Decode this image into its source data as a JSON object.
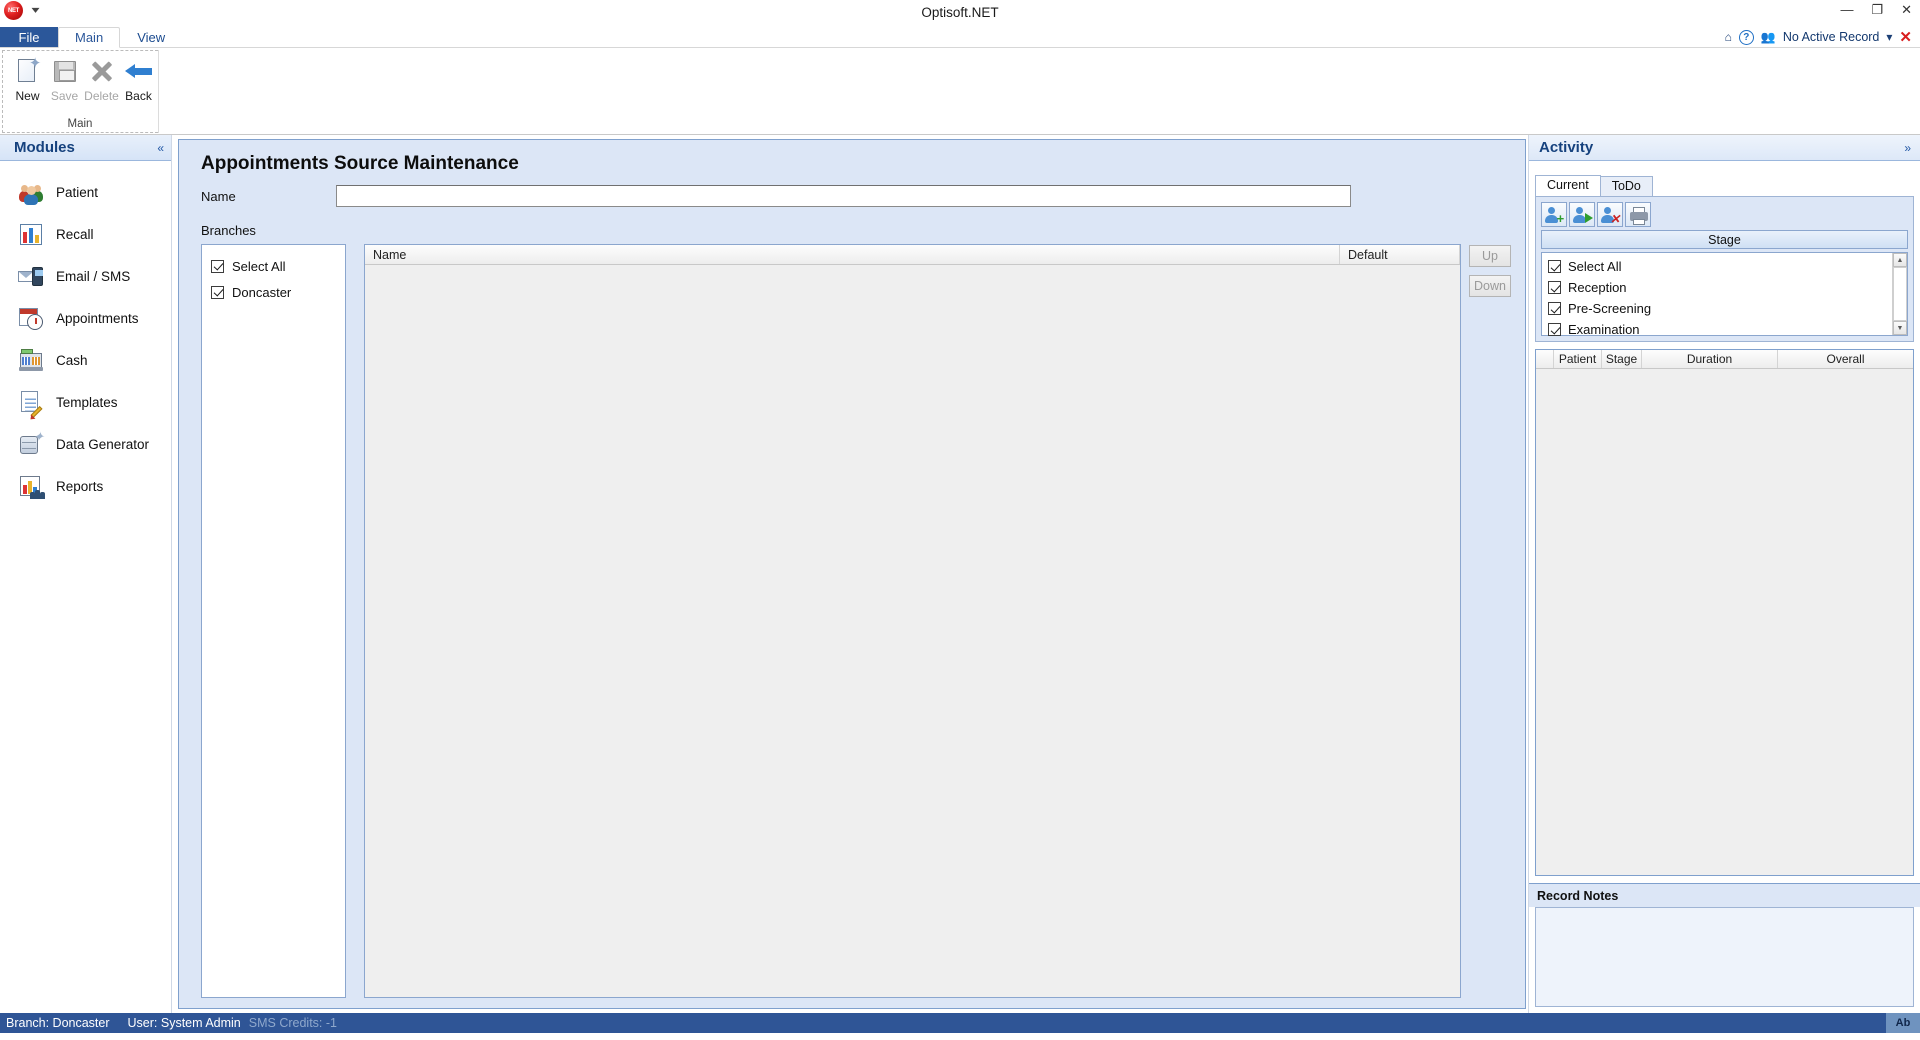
{
  "window": {
    "title": "Optisoft.NET",
    "minimize": "—",
    "restore": "❐",
    "close": "✕"
  },
  "quick_access": {
    "orb_label": "NET",
    "customize_caret": "▾"
  },
  "ribbon": {
    "tabs": [
      {
        "label": "File",
        "active": false,
        "style": "file"
      },
      {
        "label": "Main",
        "active": true,
        "style": "normal"
      },
      {
        "label": "View",
        "active": false,
        "style": "normal"
      }
    ],
    "group_title": "Main",
    "commands": [
      {
        "label": "New",
        "icon": "new-document-icon",
        "enabled": true
      },
      {
        "label": "Save",
        "icon": "save-floppy-icon",
        "enabled": false
      },
      {
        "label": "Delete",
        "icon": "delete-x-icon",
        "enabled": false
      },
      {
        "label": "Back",
        "icon": "back-arrow-icon",
        "enabled": true
      }
    ],
    "right_status": {
      "home_icon": "home-icon",
      "help_icon": "help-icon",
      "record_icon": "people-icon",
      "record_label": "No Active Record",
      "dropdown_caret": "▾",
      "close_record": "✕"
    }
  },
  "sidebar": {
    "header": "Modules",
    "collapse_icon": "«",
    "items": [
      {
        "label": "Patient",
        "icon": "patients-icon"
      },
      {
        "label": "Recall",
        "icon": "bar-chart-icon"
      },
      {
        "label": "Email / SMS",
        "icon": "email-sms-icon"
      },
      {
        "label": "Appointments",
        "icon": "calendar-clock-icon"
      },
      {
        "label": "Cash",
        "icon": "cash-register-icon"
      },
      {
        "label": "Templates",
        "icon": "document-pencil-icon"
      },
      {
        "label": "Data Generator",
        "icon": "database-star-icon"
      },
      {
        "label": "Reports",
        "icon": "reports-icon"
      }
    ]
  },
  "main": {
    "title": "Appointments Source Maintenance",
    "name_label": "Name",
    "name_value": "",
    "name_placeholder": "",
    "branches_label": "Branches",
    "branches": [
      {
        "label": "Select All",
        "checked": true
      },
      {
        "label": "Doncaster",
        "checked": true
      }
    ],
    "grid": {
      "columns": [
        "Name",
        "Default"
      ],
      "rows": []
    },
    "buttons": [
      {
        "label": "Up",
        "enabled": false
      },
      {
        "label": "Down",
        "enabled": false
      }
    ]
  },
  "activity": {
    "header": "Activity",
    "expand_icon": "»",
    "tabs": [
      {
        "label": "Current",
        "active": true
      },
      {
        "label": "ToDo",
        "active": false
      }
    ],
    "toolbar": [
      {
        "icon": "add-patient-icon"
      },
      {
        "icon": "move-patient-icon"
      },
      {
        "icon": "remove-patient-icon"
      },
      {
        "icon": "print-icon"
      }
    ],
    "stage_button": "Stage",
    "stages": [
      {
        "label": "Select All",
        "checked": true
      },
      {
        "label": "Reception",
        "checked": true
      },
      {
        "label": "Pre-Screening",
        "checked": true
      },
      {
        "label": "Examination",
        "checked": true
      }
    ],
    "scroll_up": "▲",
    "scroll_down": "▼",
    "grid": {
      "columns": [
        "",
        "Patient",
        "Stage",
        "Duration",
        "Overall"
      ],
      "rows": []
    },
    "notes_header": "Record Notes",
    "notes_value": ""
  },
  "status_bar": {
    "branch": "Branch: Doncaster",
    "user": "User: System Admin",
    "sms_credits": "SMS Credits: -1",
    "indicator": "Ab"
  }
}
